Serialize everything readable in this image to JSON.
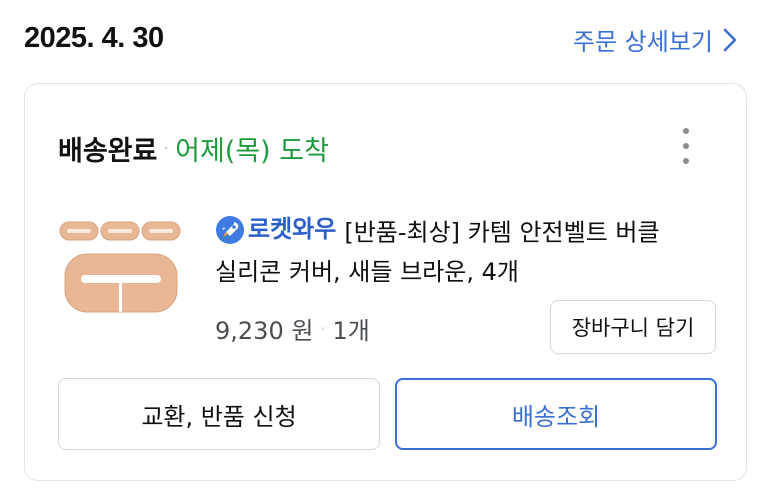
{
  "order": {
    "date": "2025. 4. 30",
    "detail_link_label": "주문 상세보기"
  },
  "card": {
    "status_label": "배송완료",
    "status_separator": "·",
    "arrival_text": "어제(목) 도착",
    "product": {
      "badge_label": "로켓와우",
      "title": "[반품-최상] 카템 안전벨트 버클 실리콘 커버, 새들 브라운, 4개",
      "price": "9,230 원",
      "separator": "·",
      "quantity": "1개",
      "image_color": "#e8b896"
    },
    "add_to_cart_label": "장바구니 담기",
    "return_exchange_label": "교환, 반품 신청",
    "track_delivery_label": "배송조회"
  },
  "colors": {
    "link_blue": "#3a6fd3",
    "arrival_green": "#1e9b3f",
    "rocket_blue": "#2d5fc8"
  },
  "icons": {
    "detail_chevron": "chevron-right-icon",
    "more_menu": "more-vertical-icon",
    "rocket_badge": "rocket-icon"
  }
}
